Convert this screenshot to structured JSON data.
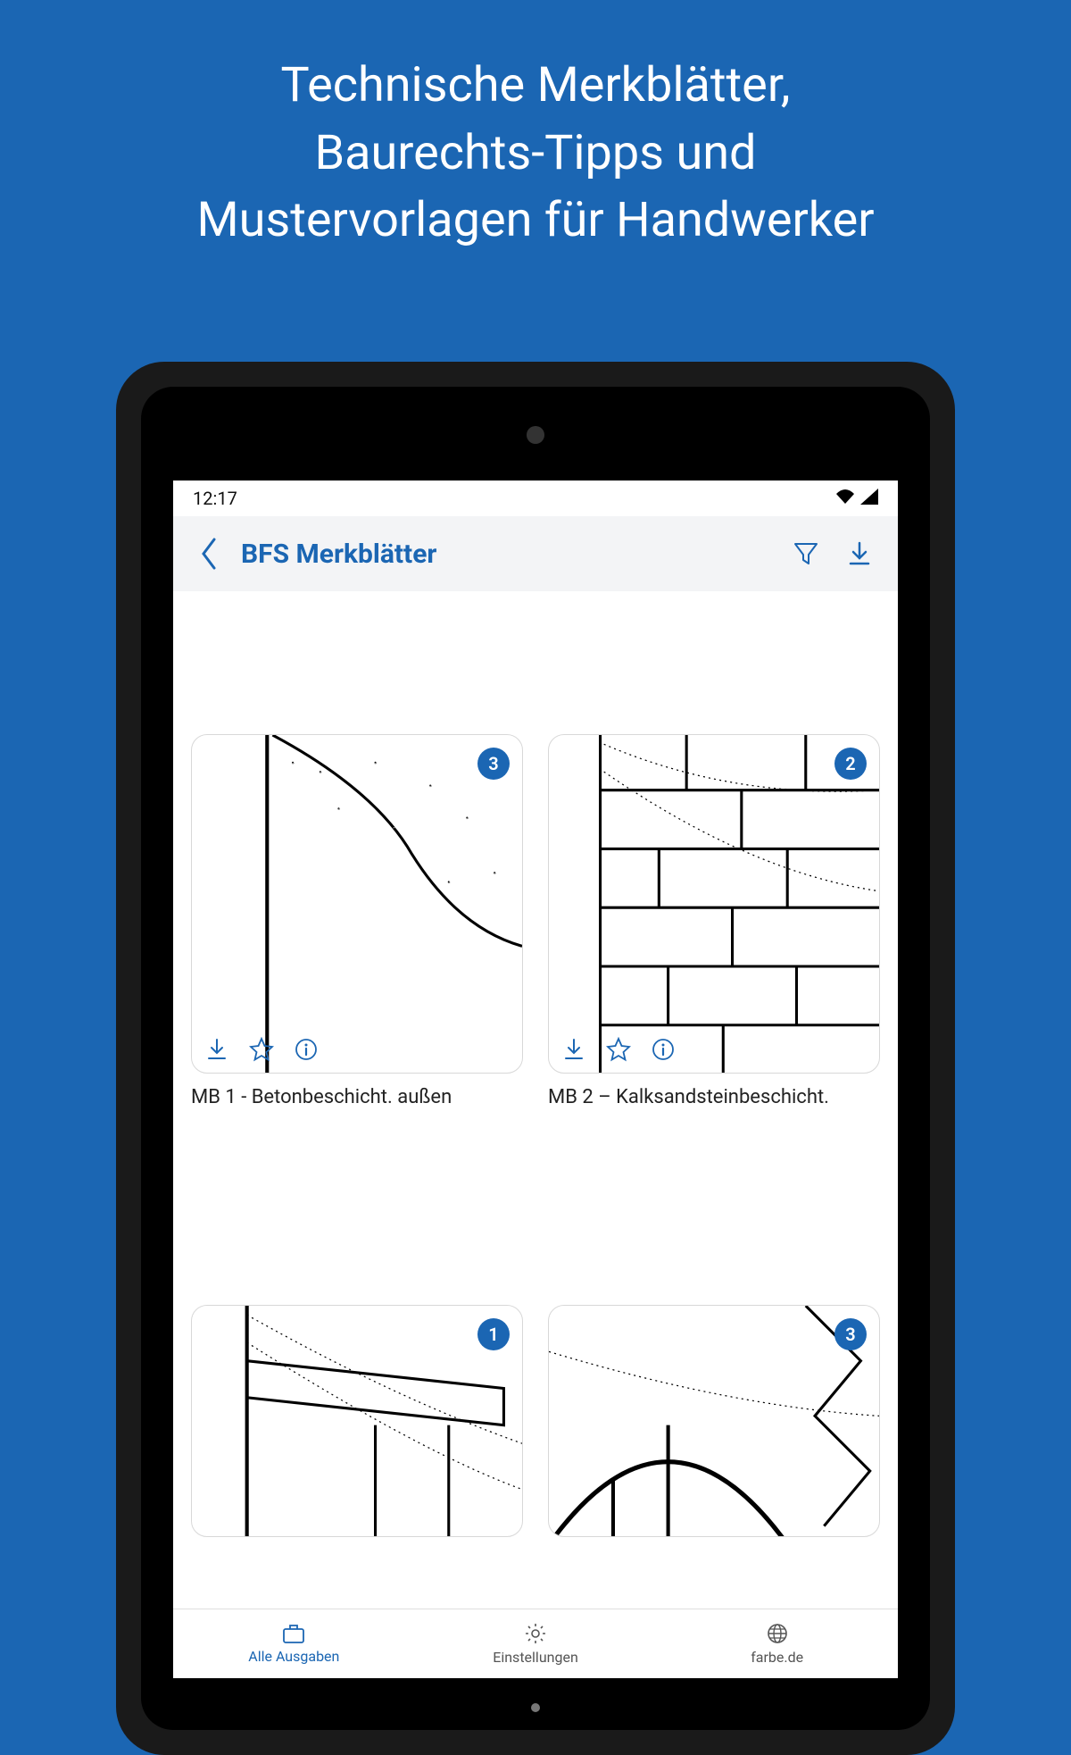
{
  "promo": {
    "line1": "Technische Merkblätter,",
    "line2": "Baurechts-Tipps und",
    "line3": "Mustervorlagen für Handwerker"
  },
  "status_bar": {
    "time": "12:17"
  },
  "header": {
    "title": "BFS Merkblätter"
  },
  "cards": [
    {
      "badge": "3",
      "title": "MB 1 - Betonbeschicht. außen"
    },
    {
      "badge": "2",
      "title": "MB 2 – Kalksandsteinbeschicht."
    },
    {
      "badge": "1",
      "title": ""
    },
    {
      "badge": "3",
      "title": ""
    }
  ],
  "bottom_nav": {
    "items": [
      {
        "label": "Alle Ausgaben"
      },
      {
        "label": "Einstellungen"
      },
      {
        "label": "farbe.de"
      }
    ]
  },
  "colors": {
    "accent": "#1b66b3"
  }
}
